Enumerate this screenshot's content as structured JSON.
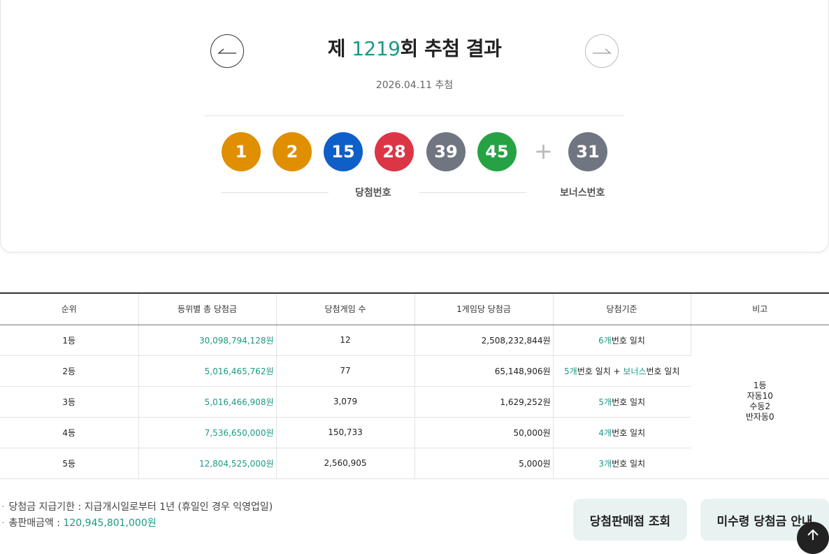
{
  "draw": {
    "title_prefix": "제 ",
    "round": "1219",
    "title_suffix": "회 추첨 결과",
    "date": "2026.04.11 추첨",
    "balls": [
      {
        "value": "1",
        "color": "#e08f00"
      },
      {
        "value": "2",
        "color": "#e08f00"
      },
      {
        "value": "15",
        "color": "#0f5fc8"
      },
      {
        "value": "28",
        "color": "#dc3545"
      },
      {
        "value": "39",
        "color": "#707582"
      },
      {
        "value": "45",
        "color": "#26a244"
      }
    ],
    "plus": "+",
    "bonus": {
      "value": "31",
      "color": "#707582"
    },
    "winning_label": "당첨번호",
    "bonus_label": "보너스번호"
  },
  "table": {
    "headers": [
      "순위",
      "등위별 총 당첨금",
      "당첨게임 수",
      "1게임당 당첨금",
      "당첨기준",
      "비고"
    ],
    "rows": [
      {
        "rank": "1등",
        "total": "30,098,794,128원",
        "games": "12",
        "per_game": "2,508,232,844원",
        "crit_num": "6개",
        "crit_text": "번호 일치",
        "crit_bonus": "",
        "crit_tail": ""
      },
      {
        "rank": "2등",
        "total": "5,016,465,762원",
        "games": "77",
        "per_game": "65,148,906원",
        "crit_num": "5개",
        "crit_text": "번호 일치 + ",
        "crit_bonus": "보너스",
        "crit_tail": "번호 일치"
      },
      {
        "rank": "3등",
        "total": "5,016,466,908원",
        "games": "3,079",
        "per_game": "1,629,252원",
        "crit_num": "5개",
        "crit_text": "번호 일치",
        "crit_bonus": "",
        "crit_tail": ""
      },
      {
        "rank": "4등",
        "total": "7,536,650,000원",
        "games": "150,733",
        "per_game": "50,000원",
        "crit_num": "4개",
        "crit_text": "번호 일치",
        "crit_bonus": "",
        "crit_tail": ""
      },
      {
        "rank": "5등",
        "total": "12,804,525,000원",
        "games": "2,560,905",
        "per_game": "5,000원",
        "crit_num": "3개",
        "crit_text": "번호 일치",
        "crit_bonus": "",
        "crit_tail": ""
      }
    ],
    "note_lines": [
      "1등",
      "자동10",
      "수동2",
      "반자동0"
    ]
  },
  "notes": {
    "bullet": "·",
    "deadline_label": "당첨금 지급기한 : 지급개시일로부터 1년 (휴일인 경우 익영업일)",
    "sales_label": "총판매금액 : ",
    "sales_value": "120,945,801,000원"
  },
  "buttons": {
    "stores": "당첨판매점 조회",
    "unclaimed": "미수령 당첨금 안내"
  }
}
